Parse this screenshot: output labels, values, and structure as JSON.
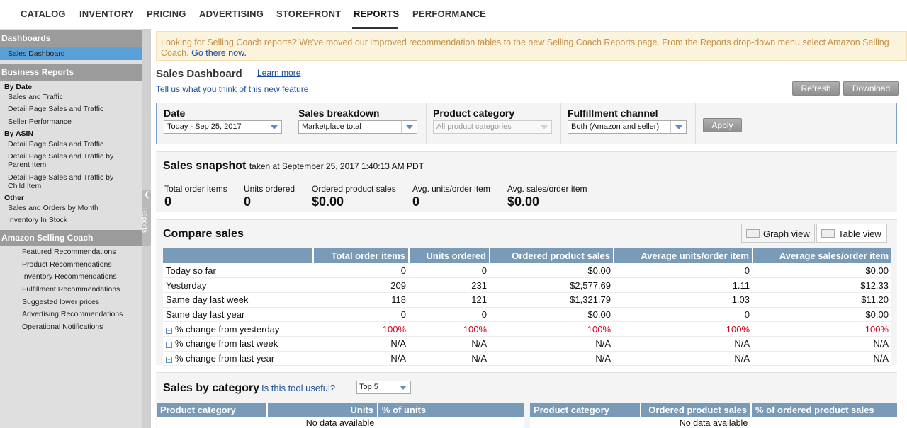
{
  "nav": {
    "tabs": [
      "CATALOG",
      "INVENTORY",
      "PRICING",
      "ADVERTISING",
      "STOREFRONT",
      "REPORTS",
      "PERFORMANCE"
    ],
    "active": "REPORTS"
  },
  "sidebar": {
    "dashboards_header": "Dashboards",
    "sales_dashboard": "Sales Dashboard",
    "business_reports_header": "Business Reports",
    "by_date": "By Date",
    "by_date_items": [
      "Sales and Traffic",
      "Detail Page Sales and Traffic",
      "Seller Performance"
    ],
    "by_asin": "By ASIN",
    "by_asin_items": [
      "Detail Page Sales and Traffic",
      "Detail Page Sales and Traffic by",
      "Parent Item",
      "Detail Page Sales and Traffic by",
      "Child Item"
    ],
    "other": "Other",
    "other_items": [
      "Sales and Orders by Month",
      "Inventory In Stock"
    ],
    "selling_coach_header": "Amazon Selling Coach",
    "selling_coach_items": [
      "Featured Recommendations",
      "Product Recommendations",
      "Inventory Recommendations",
      "Fulfillment Recommendations",
      "Suggested lower prices",
      "Advertising Recommendations",
      "Operational Notifications"
    ],
    "collapse_label": "Reports"
  },
  "notice": {
    "text": "Looking for Selling Coach reports? We've moved our improved recommendation tables to the new Selling Coach Reports page. From the Reports drop-down menu select Amazon Selling Coach.",
    "link": "Go there now."
  },
  "header": {
    "title": "Sales Dashboard",
    "learn_more": "Learn more",
    "feedback": "Tell us what you think of this new feature",
    "refresh": "Refresh",
    "download": "Download"
  },
  "filters": {
    "date_label": "Date",
    "date_value": "Today - Sep 25, 2017",
    "breakdown_label": "Sales breakdown",
    "breakdown_value": "Marketplace total",
    "category_label": "Product category",
    "category_value": "All product categories",
    "channel_label": "Fulfillment channel",
    "channel_value": "Both (Amazon and seller)",
    "apply": "Apply"
  },
  "snapshot": {
    "title": "Sales snapshot",
    "taken": "taken at September 25, 2017 1:40:13 AM PDT",
    "metrics": [
      {
        "label": "Total order items",
        "value": "0"
      },
      {
        "label": "Units ordered",
        "value": "0"
      },
      {
        "label": "Ordered product sales",
        "value": "$0.00"
      },
      {
        "label": "Avg. units/order item",
        "value": "0"
      },
      {
        "label": "Avg. sales/order item",
        "value": "$0.00"
      }
    ]
  },
  "compare": {
    "title": "Compare sales",
    "graph_view": "Graph view",
    "table_view": "Table view",
    "headers": [
      "",
      "Total order items",
      "Units ordered",
      "Ordered product sales",
      "Average units/order item",
      "Average sales/order item"
    ],
    "rows": [
      [
        "Today so far",
        "0",
        "0",
        "$0.00",
        "0",
        "$0.00"
      ],
      [
        "Yesterday",
        "209",
        "231",
        "$2,577.69",
        "1.11",
        "$12.33"
      ],
      [
        "Same day last week",
        "118",
        "121",
        "$1,321.79",
        "1.03",
        "$11.20"
      ],
      [
        "Same day last year",
        "0",
        "0",
        "$0.00",
        "0",
        "$0.00"
      ],
      [
        "% change from yesterday",
        "-100%",
        "-100%",
        "-100%",
        "-100%",
        "-100%"
      ],
      [
        "% change from last week",
        "N/A",
        "N/A",
        "N/A",
        "N/A",
        "N/A"
      ],
      [
        "% change from last year",
        "N/A",
        "N/A",
        "N/A",
        "N/A",
        "N/A"
      ]
    ]
  },
  "category": {
    "title": "Sales by category",
    "useful_link": "Is this tool useful?",
    "top_value": "Top 5",
    "left_headers": [
      "Product category",
      "Units",
      "% of units"
    ],
    "right_headers": [
      "Product category",
      "Ordered product sales",
      "% of ordered product sales"
    ],
    "no_data": "No data available"
  }
}
